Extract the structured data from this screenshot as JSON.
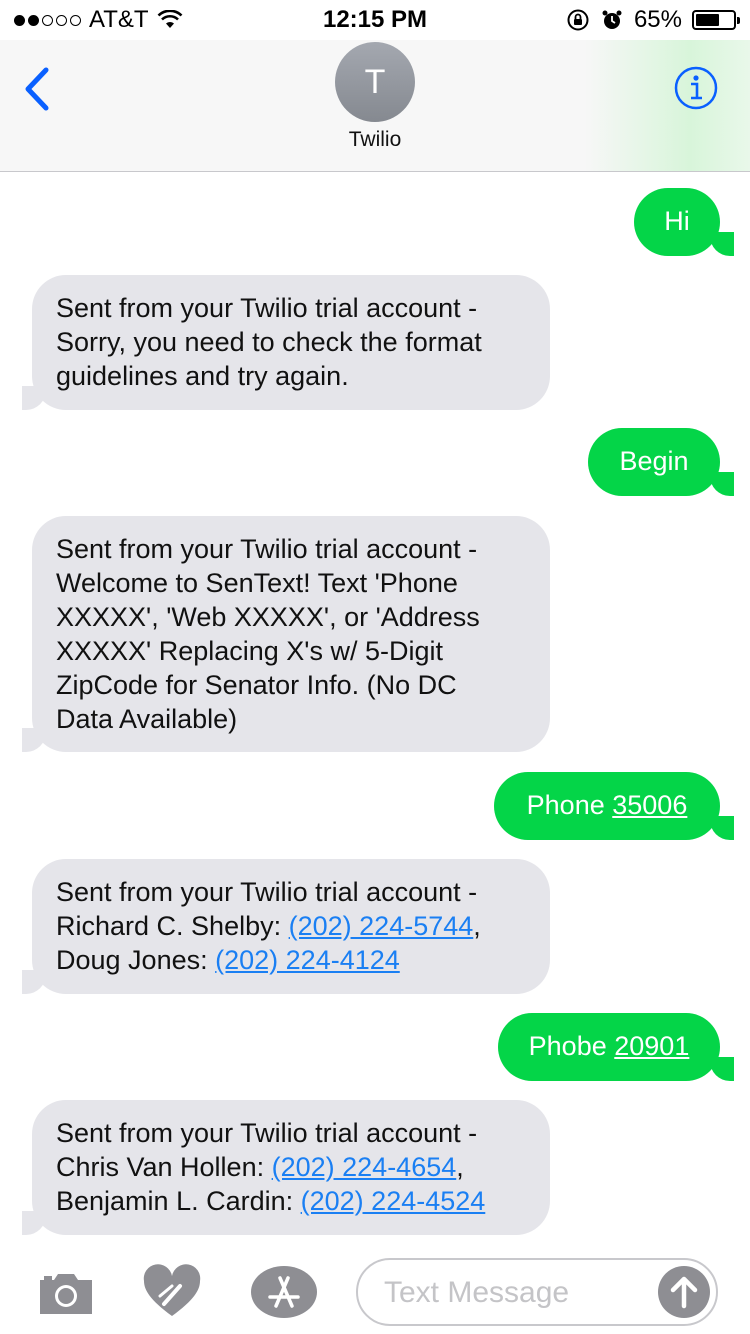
{
  "status_bar": {
    "carrier": "AT&T",
    "time": "12:15 PM",
    "battery_percent": "65%",
    "battery_level": 0.65,
    "signal_bars_filled": 2,
    "signal_bars_total": 5
  },
  "header": {
    "avatar_initial": "T",
    "contact_name": "Twilio",
    "back_icon": "chevron-left-icon",
    "info_icon": "info-icon",
    "accent_color": "#0a60ff"
  },
  "messages": [
    {
      "dir": "out",
      "text": "Hi"
    },
    {
      "dir": "in",
      "lines": [
        "Sent from your Twilio trial account -",
        "Sorry, you need to check the format",
        "guidelines and try again."
      ]
    },
    {
      "dir": "out",
      "text": "Begin"
    },
    {
      "dir": "in",
      "lines": [
        "Sent from your Twilio trial account -",
        "Welcome to SenText! Text 'Phone",
        "XXXXX', 'Web XXXXX', or 'Address",
        "XXXXX' Replacing X's w/ 5-Digit",
        "ZipCode for Senator Info. (No DC",
        "Data Available)"
      ]
    },
    {
      "dir": "out",
      "word": "Phone",
      "link": "35006"
    },
    {
      "dir": "in",
      "line1": "Sent from your Twilio trial account -",
      "name1": "Richard C. Shelby:",
      "phone1": "(202) 224-5744",
      "name2": "Doug Jones:",
      "phone2": "(202) 224-4124"
    },
    {
      "dir": "out",
      "word": "Phobe",
      "link": "20901"
    },
    {
      "dir": "in",
      "line1": "Sent from your Twilio trial account -",
      "name1": "Chris Van Hollen:",
      "phone1": "(202) 224-4654",
      "name2": "Benjamin L. Cardin:",
      "phone2": "(202) 224-4524"
    }
  ],
  "input_bar": {
    "placeholder": "Text Message",
    "camera_icon": "camera-icon",
    "digital_touch_icon": "digital-touch-heart-icon",
    "app_store_icon": "app-store-icon",
    "send_icon": "arrow-up-icon"
  },
  "colors": {
    "outgoing_bubble": "#04d548",
    "incoming_bubble": "#e5e5ea",
    "link": "#1a7ff3"
  }
}
